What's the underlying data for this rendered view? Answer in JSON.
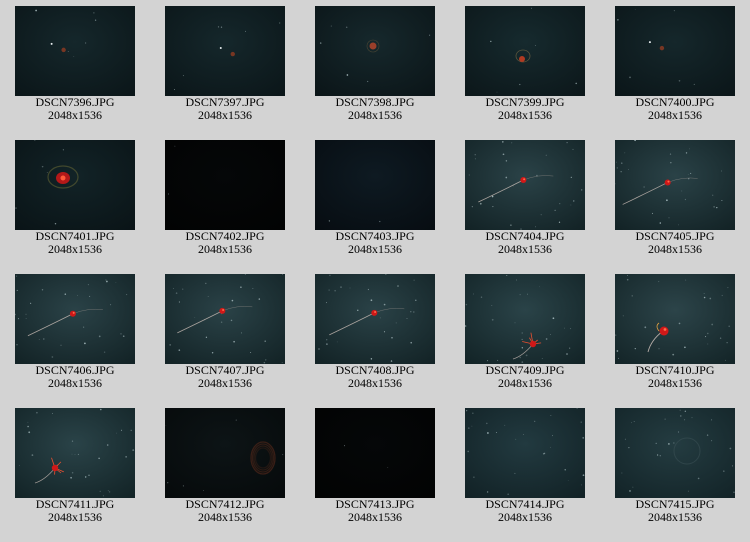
{
  "gallery": {
    "images": [
      {
        "filename": "DSCN7396.JPG",
        "dimensions": "2048x1536",
        "scene": "tiny-red-speck"
      },
      {
        "filename": "DSCN7397.JPG",
        "dimensions": "2048x1536",
        "scene": "tiny-red-speck"
      },
      {
        "filename": "DSCN7398.JPG",
        "dimensions": "2048x1536",
        "scene": "small-red-speck"
      },
      {
        "filename": "DSCN7399.JPG",
        "dimensions": "2048x1536",
        "scene": "small-red-jelly"
      },
      {
        "filename": "DSCN7400.JPG",
        "dimensions": "2048x1536",
        "scene": "tiny-red-speck"
      },
      {
        "filename": "DSCN7401.JPG",
        "dimensions": "2048x1536",
        "scene": "red-jelly-halo"
      },
      {
        "filename": "DSCN7402.JPG",
        "dimensions": "2048x1536",
        "scene": "black"
      },
      {
        "filename": "DSCN7403.JPG",
        "dimensions": "2048x1536",
        "scene": "dark-blue"
      },
      {
        "filename": "DSCN7404.JPG",
        "dimensions": "2048x1536",
        "scene": "red-creature-long-tail"
      },
      {
        "filename": "DSCN7405.JPG",
        "dimensions": "2048x1536",
        "scene": "red-creature-long-tail"
      },
      {
        "filename": "DSCN7406.JPG",
        "dimensions": "2048x1536",
        "scene": "red-creature-long-tail"
      },
      {
        "filename": "DSCN7407.JPG",
        "dimensions": "2048x1536",
        "scene": "red-creature-long-tail"
      },
      {
        "filename": "DSCN7408.JPG",
        "dimensions": "2048x1536",
        "scene": "red-creature-long-tail"
      },
      {
        "filename": "DSCN7409.JPG",
        "dimensions": "2048x1536",
        "scene": "red-creature-tentacles"
      },
      {
        "filename": "DSCN7410.JPG",
        "dimensions": "2048x1536",
        "scene": "red-creature-curled-tail"
      },
      {
        "filename": "DSCN7411.JPG",
        "dimensions": "2048x1536",
        "scene": "red-creature-tentacles"
      },
      {
        "filename": "DSCN7412.JPG",
        "dimensions": "2048x1536",
        "scene": "brown-ring-jelly"
      },
      {
        "filename": "DSCN7413.JPG",
        "dimensions": "2048x1536",
        "scene": "black"
      },
      {
        "filename": "DSCN7414.JPG",
        "dimensions": "2048x1536",
        "scene": "particles"
      },
      {
        "filename": "DSCN7415.JPG",
        "dimensions": "2048x1536",
        "scene": "particles-faint-jelly"
      }
    ]
  },
  "colors": {
    "page_background": "#d3d3d3",
    "caption_text": "#000000",
    "water_dark": "#0d1a1d",
    "water_mid": "#1c3035",
    "creature_red": "#d01818"
  }
}
